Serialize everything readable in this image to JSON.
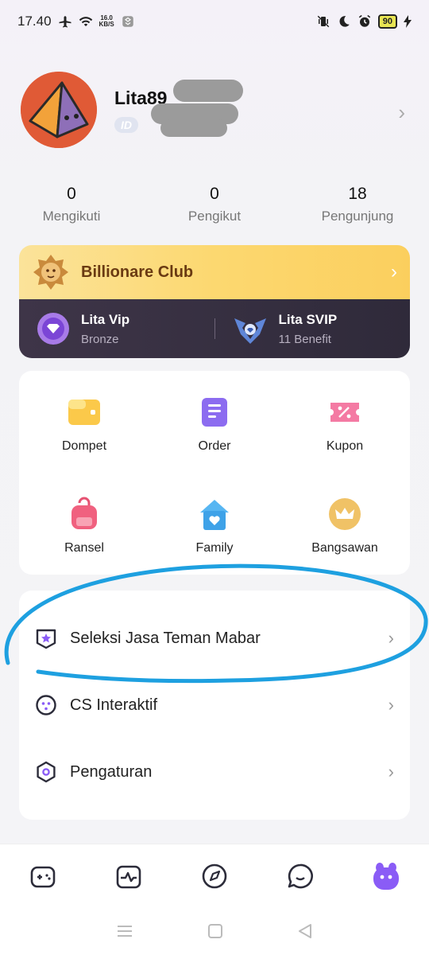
{
  "status_bar": {
    "time": "17.40",
    "net_speed_value": "16.0",
    "net_speed_unit": "KB/S",
    "battery": "90"
  },
  "profile": {
    "username": "Lita89",
    "id_label": "ID"
  },
  "stats": [
    {
      "value": "0",
      "label": "Mengikuti"
    },
    {
      "value": "0",
      "label": "Pengikut"
    },
    {
      "value": "18",
      "label": "Pengunjung"
    }
  ],
  "club": {
    "title": "Billionare Club",
    "vip": {
      "name": "Lita Vip",
      "sub": "Bronze"
    },
    "svip": {
      "name": "Lita SVIP",
      "sub": "11 Benefit"
    }
  },
  "grid": [
    {
      "label": "Dompet",
      "icon": "wallet-icon"
    },
    {
      "label": "Order",
      "icon": "order-icon"
    },
    {
      "label": "Kupon",
      "icon": "coupon-icon"
    },
    {
      "label": "Ransel",
      "icon": "backpack-icon"
    },
    {
      "label": "Family",
      "icon": "family-house-icon"
    },
    {
      "label": "Bangsawan",
      "icon": "crown-icon"
    }
  ],
  "menu": [
    {
      "label": "Seleksi Jasa Teman Mabar",
      "icon": "shield-star-icon"
    },
    {
      "label": "CS Interaktif",
      "icon": "cs-face-icon"
    },
    {
      "label": "Pengaturan",
      "icon": "settings-hex-icon"
    }
  ],
  "bottom_nav": [
    "gamepad-icon",
    "activity-icon",
    "compass-icon",
    "chat-icon",
    "profile-mascot-icon"
  ],
  "colors": {
    "accent": "#8a5cf6",
    "annotation": "#1ea0e0"
  }
}
